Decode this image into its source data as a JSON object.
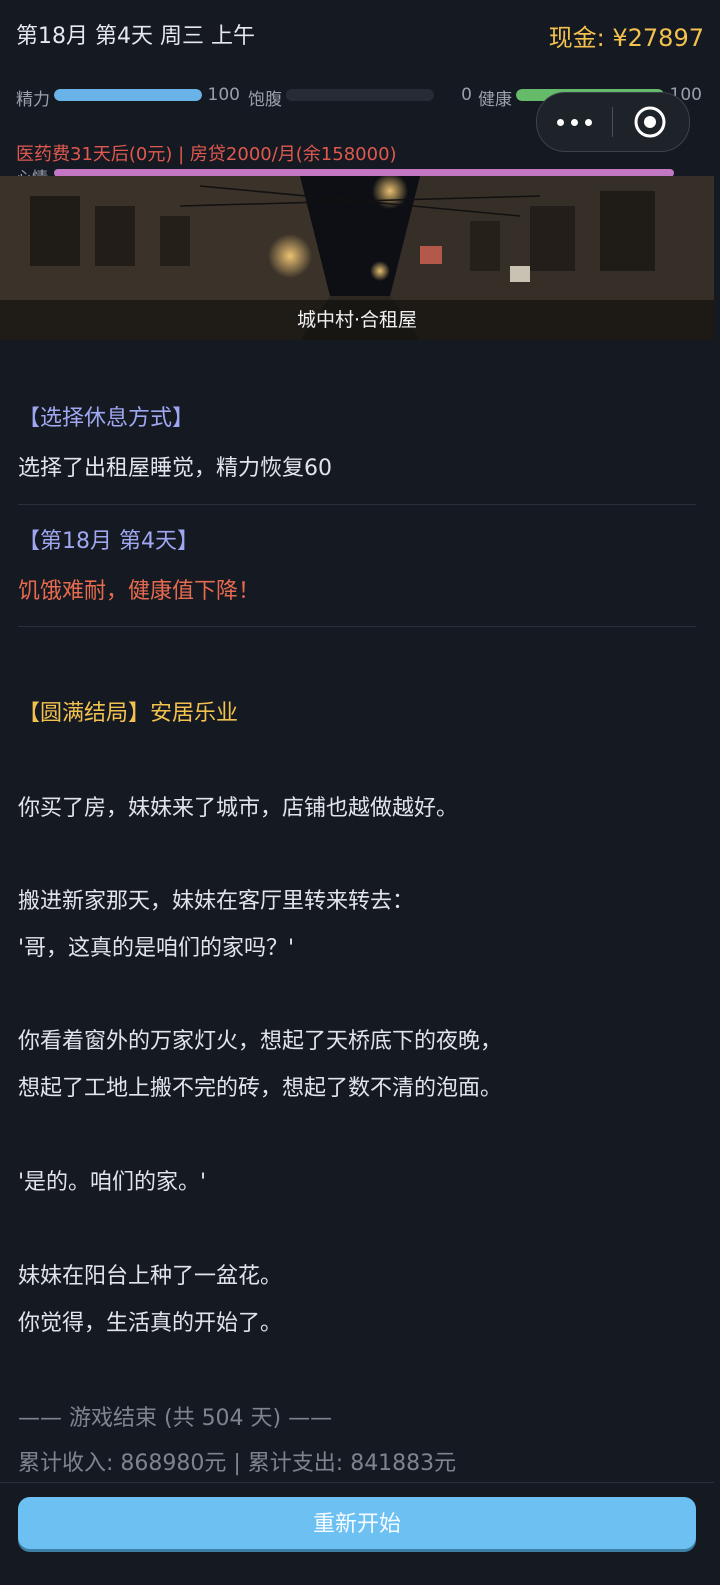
{
  "header": {
    "date": "第18月 第4天 周三 上午",
    "cash": "现金: ¥27897"
  },
  "stats": [
    {
      "label": "精力",
      "value": "100",
      "level": 1.0,
      "color": "#6ab3e8"
    },
    {
      "label": "饱腹",
      "value": "0",
      "level": 0.0,
      "color": "#3a3f48"
    },
    {
      "label": "健康",
      "value": "100",
      "level": 1.0,
      "color": "#66bb6a"
    }
  ],
  "mood": {
    "label": "心情",
    "value": "100",
    "level": 1.0,
    "color": "#c477c2"
  },
  "alert": "医药费31天后(0元) | 房贷2000/月(余158000)",
  "scene": {
    "caption": "城中村·合租屋"
  },
  "log": {
    "entry1": {
      "title": "【选择休息方式】",
      "text": "选择了出租屋睡觉，精力恢复60"
    },
    "entry2": {
      "title": "【第18月 第4天】",
      "text": "饥饿难耐，健康值下降！"
    }
  },
  "ending": {
    "title": "【圆满结局】安居乐业",
    "lines": [
      "你买了房，妹妹来了城市，店铺也越做越好。",
      "搬进新家那天，妹妹在客厅里转来转去：",
      "'哥，这真的是咱们的家吗？'",
      "你看着窗外的万家灯火，想起了天桥底下的夜晚，",
      "想起了工地上搬不完的砖，想起了数不清的泡面。",
      "'是的。咱们的家。'",
      "妹妹在阳台上种了一盆花。",
      "你觉得，生活真的开始了。"
    ],
    "game_over": "—— 游戏结束 (共 504 天) ——",
    "totals": "累计收入: 868980元 | 累计支出: 841883元"
  },
  "footer": {
    "restart_label": "重新开始"
  },
  "capsule": {
    "more_icon": "more-dots-icon",
    "close_icon": "target-circle-icon"
  }
}
